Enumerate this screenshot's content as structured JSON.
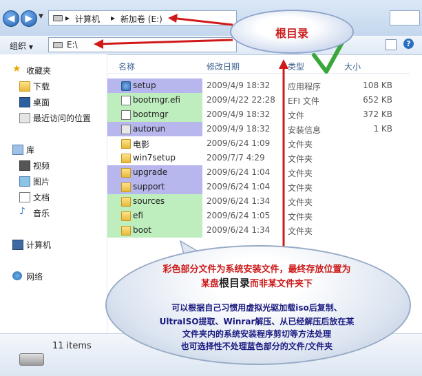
{
  "address_bar": {
    "path": [
      "计算机",
      "新加卷 (E:)"
    ],
    "overlay_path": "E:\\"
  },
  "toolbar": {
    "organize_label": "组织"
  },
  "sidebar": {
    "favorites_header": "收藏夹",
    "favorites": [
      "下载",
      "桌面",
      "最近访问的位置"
    ],
    "libraries_header": "库",
    "libraries": [
      "视频",
      "图片",
      "文档",
      "音乐"
    ],
    "computer": "计算机",
    "network": "网络"
  },
  "columns": {
    "name": "名称",
    "date": "修改日期",
    "type": "类型",
    "size": "大小"
  },
  "files": [
    {
      "name": "setup",
      "date": "2009/4/9 18:32",
      "type": "应用程序",
      "size": "108 KB",
      "icon": "exe-icon",
      "highlight": "#b7b7ee"
    },
    {
      "name": "bootmgr.efi",
      "date": "2009/4/22 22:28",
      "type": "EFI 文件",
      "size": "652 KB",
      "icon": "file-icon",
      "highlight": "#bfeebe"
    },
    {
      "name": "bootmgr",
      "date": "2009/4/9 18:32",
      "type": "文件",
      "size": "372 KB",
      "icon": "file-icon",
      "highlight": "#bfeebe"
    },
    {
      "name": "autorun",
      "date": "2009/4/9 18:32",
      "type": "安装信息",
      "size": "1 KB",
      "icon": "inf-icon",
      "highlight": "#b7b7ee"
    },
    {
      "name": "电影",
      "date": "2009/6/24 1:09",
      "type": "文件夹",
      "size": "",
      "icon": "folder-icon",
      "highlight": ""
    },
    {
      "name": "win7setup",
      "date": "2009/7/7 4:29",
      "type": "文件夹",
      "size": "",
      "icon": "folder-icon",
      "highlight": ""
    },
    {
      "name": "upgrade",
      "date": "2009/6/24 1:04",
      "type": "文件夹",
      "size": "",
      "icon": "folder-icon",
      "highlight": "#b7b7ee"
    },
    {
      "name": "support",
      "date": "2009/6/24 1:04",
      "type": "文件夹",
      "size": "",
      "icon": "folder-icon",
      "highlight": "#b7b7ee"
    },
    {
      "name": "sources",
      "date": "2009/6/24 1:34",
      "type": "文件夹",
      "size": "",
      "icon": "folder-icon",
      "highlight": "#bfeebe"
    },
    {
      "name": "efi",
      "date": "2009/6/24 1:05",
      "type": "文件夹",
      "size": "",
      "icon": "folder-icon",
      "highlight": "#bfeebe"
    },
    {
      "name": "boot",
      "date": "2009/6/24 1:34",
      "type": "文件夹",
      "size": "",
      "icon": "folder-icon",
      "highlight": "#bfeebe"
    }
  ],
  "status": {
    "item_count": "11 items"
  },
  "annotations": {
    "cloud_label": "根目录",
    "bubble_line1": "彩色部分文件为系统安装文件，最终存放位置为",
    "bubble_line2_a": "某盘",
    "bubble_line2_b": "根目录",
    "bubble_line2_c": "而非某文件夹下",
    "bubble_line3": "可以根据自己习惯用虚拟光驱加载iso后复制、",
    "bubble_line4": "UltraISO提取、Winrar解压、从已经解压后放在某",
    "bubble_line5": "文件夹内的系统安装程序剪切等方法处理",
    "bubble_line6": "也可选择性不处理蓝色部分的文件/文件夹",
    "red_color": "#cc1a1a",
    "navy_color": "#1a1a80"
  }
}
